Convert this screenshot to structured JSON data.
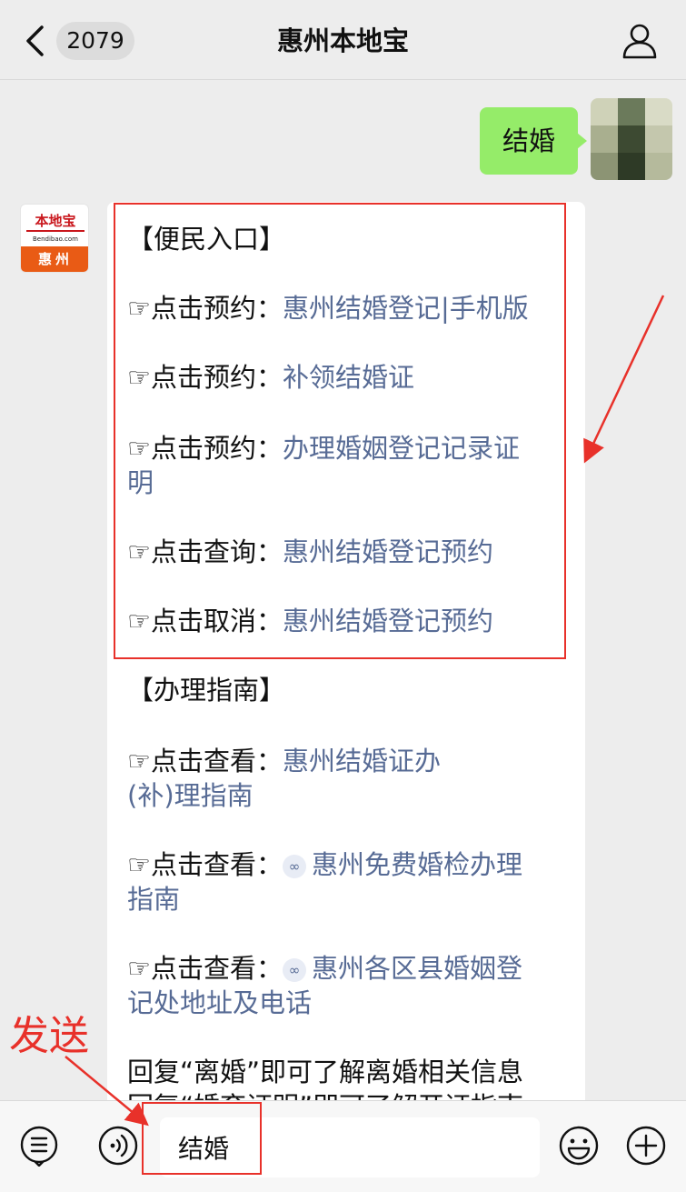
{
  "header": {
    "unread_count": "2079",
    "title": "惠州本地宝"
  },
  "outgoing_message": "结婚",
  "bot_avatar": {
    "logo_top": "本地宝",
    "logo_url": "Bendibao.com",
    "logo_city": "惠州"
  },
  "reply": {
    "section1_heading": "【便民入口】",
    "section2_heading": "【办理指南】",
    "items": [
      {
        "prefix": "☞点击预约：",
        "link": "惠州结婚登记|手机版"
      },
      {
        "prefix": "☞点击预约：",
        "link": "补领结婚证"
      },
      {
        "prefix": "☞点击预约：",
        "link": "办理婚姻登记记录证",
        "link_cont": "明"
      },
      {
        "prefix": "☞点击查询：",
        "link": "惠州结婚登记预约"
      },
      {
        "prefix": "☞点击取消：",
        "link": "惠州结婚登记预约"
      },
      {
        "prefix": "☞点击查看：",
        "link": "惠州结婚证办",
        "link_cont": "(补)理指南"
      },
      {
        "prefix": "☞点击查看：",
        "link": "惠州免费婚检办理",
        "link_cont": "指南"
      },
      {
        "prefix": "☞点击查看：",
        "link": "惠州各区县婚姻登",
        "link_cont": "记处地址及电话"
      }
    ],
    "footer_line1": "回复“离婚”即可了解离婚相关信息",
    "footer_line2": "回复“婚育证明”即可了解开证指南"
  },
  "annotation": {
    "send_label": "发送",
    "accent_color": "#e8312a"
  },
  "input_bar": {
    "value": "结婚",
    "icons": [
      "menu-list-icon",
      "voice-icon",
      "emoji-icon",
      "plus-icon"
    ]
  },
  "colors": {
    "outgoing_bubble": "#95ec69",
    "link": "#576b95",
    "background": "#ededed"
  }
}
